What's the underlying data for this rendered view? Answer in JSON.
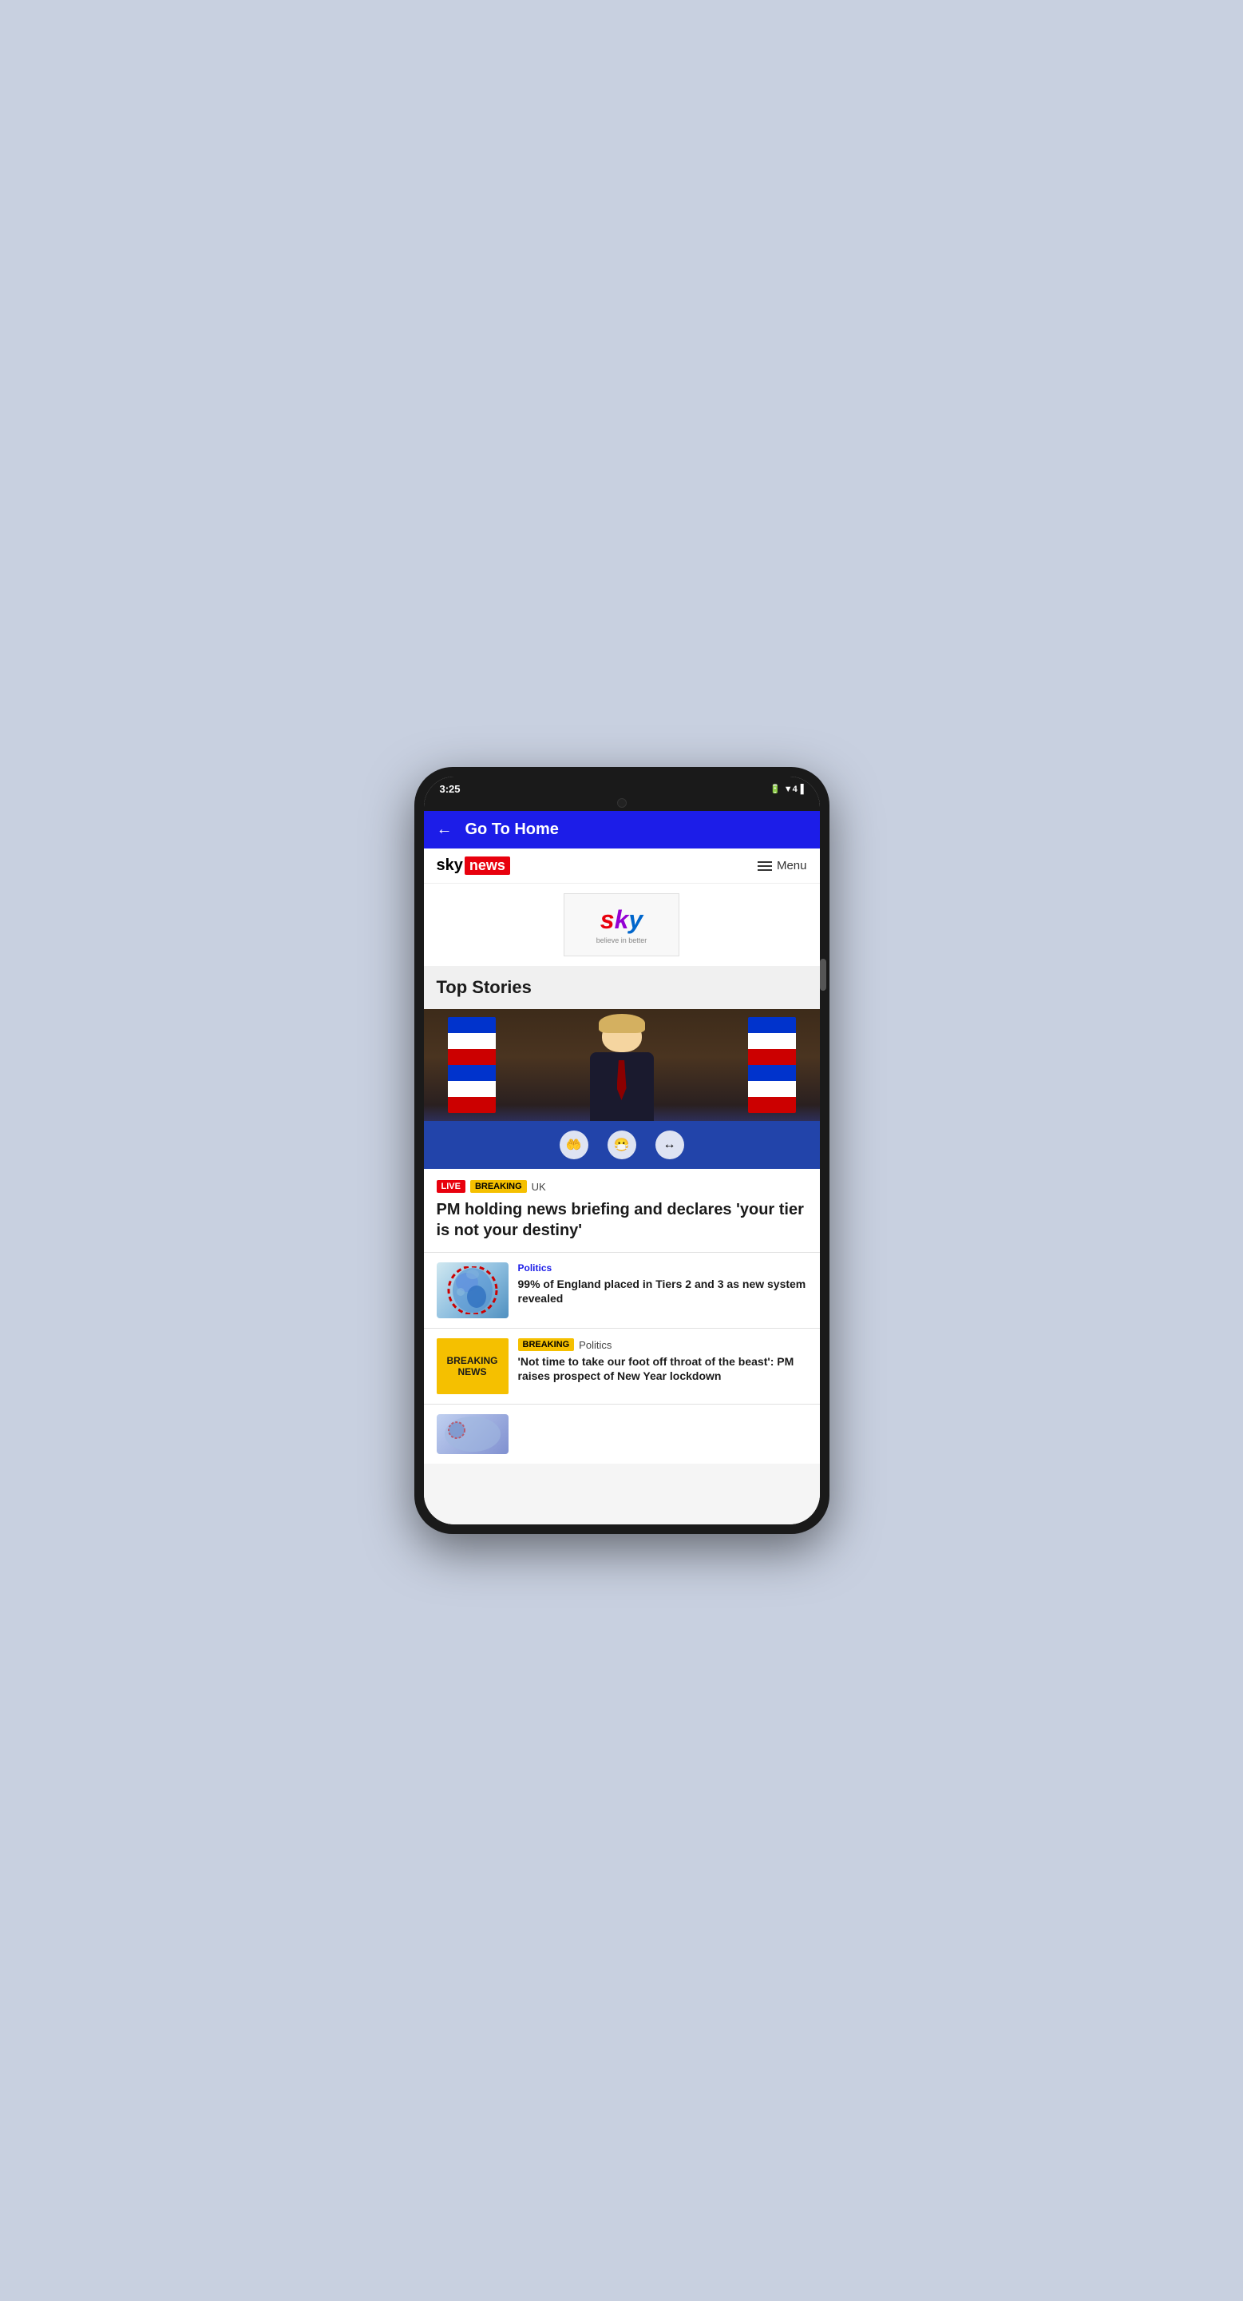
{
  "device": {
    "time": "3:25",
    "status_icons": "▼4▐"
  },
  "app_bar": {
    "back_label": "←",
    "title": "Go To Home"
  },
  "sky_header": {
    "logo_sky": "sky",
    "logo_news": "news",
    "menu_label": "Menu"
  },
  "sky_ad": {
    "logo_s": "s",
    "logo_k": "k",
    "logo_y": "y",
    "tagline": "believe in better"
  },
  "top_stories": {
    "label": "Top Stories"
  },
  "hero_article": {
    "tag_live": "LIVE",
    "tag_breaking": "BREAKING",
    "tag_category": "UK",
    "headline": "PM holding news briefing and declares 'your tier is not your destiny'"
  },
  "articles": [
    {
      "category": "Politics",
      "title": "99% of England placed in Tiers 2 and 3 as new system revealed",
      "type": "map"
    },
    {
      "tag": "BREAKING",
      "category": "Politics",
      "title": "'Not time to take our foot off throat of the beast': PM raises prospect of New Year lockdown",
      "type": "breaking",
      "thumb_line1": "BREAKING",
      "thumb_line2": "NEWS"
    }
  ],
  "podium_icons": [
    "🤲",
    "😷",
    "↔"
  ]
}
